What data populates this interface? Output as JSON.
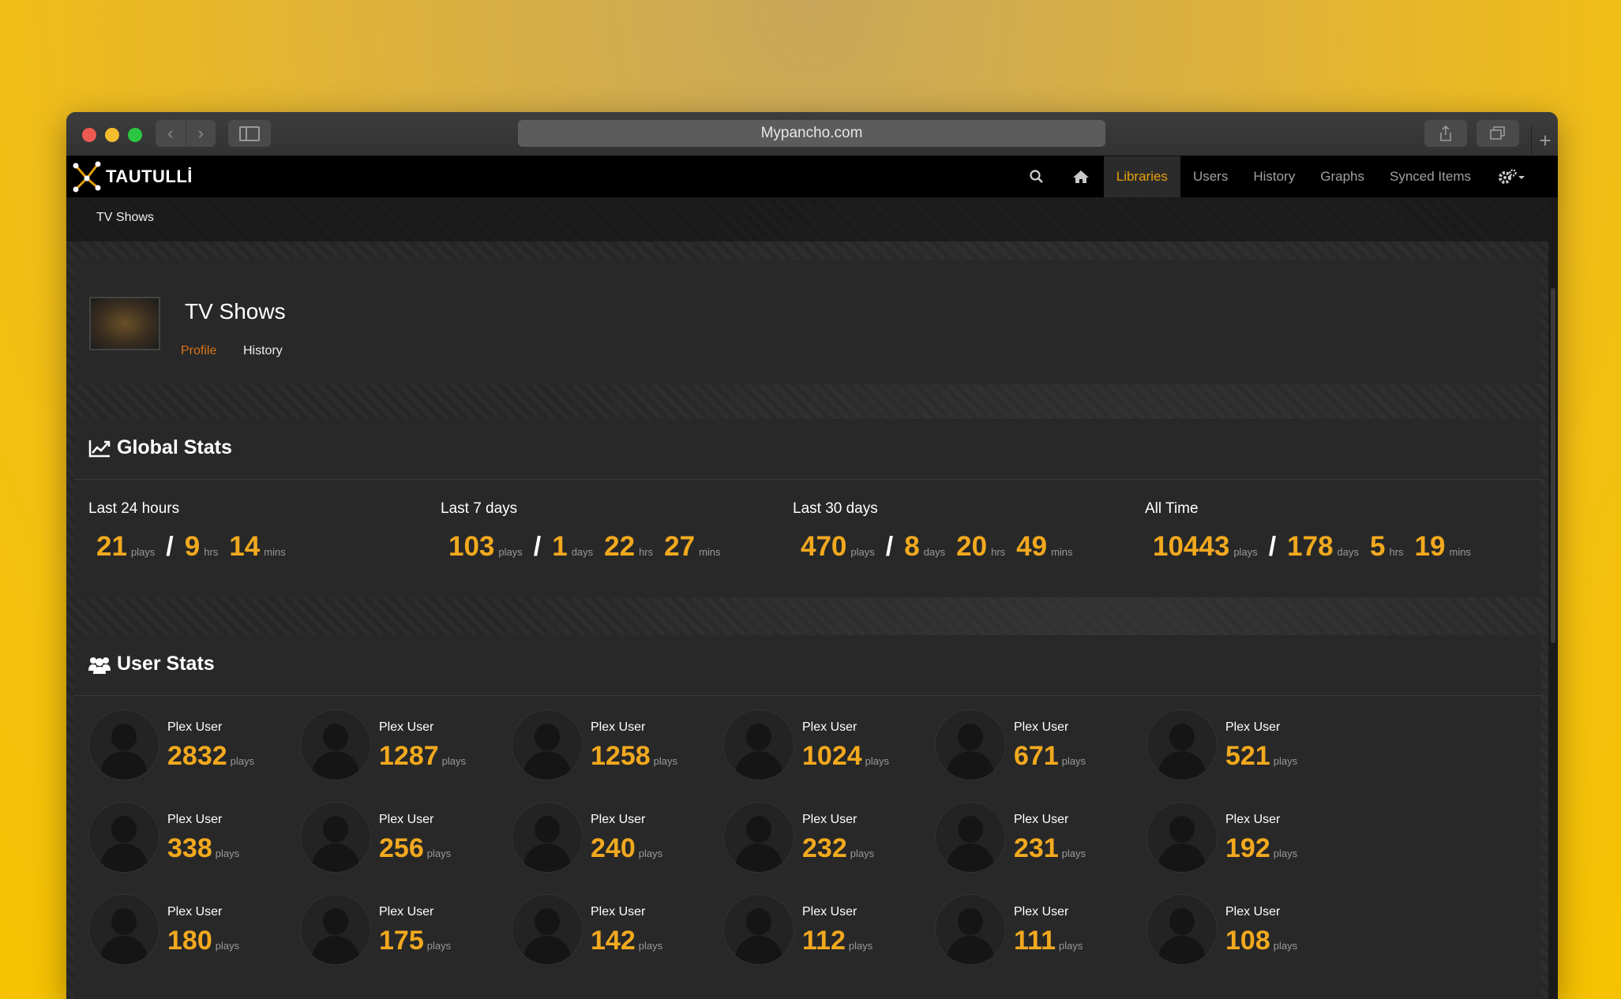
{
  "browser": {
    "url": "Mypancho.com"
  },
  "app": {
    "brand": "TAUTULLİ",
    "nav": {
      "libraries": "Libraries",
      "users": "Users",
      "history": "History",
      "graphs": "Graphs",
      "synced": "Synced Items"
    }
  },
  "breadcrumb": "TV Shows",
  "library": {
    "title": "TV Shows",
    "tabs": {
      "profile": "Profile",
      "history": "History"
    }
  },
  "global_stats": {
    "title": "Global Stats",
    "periods": [
      {
        "label": "Last 24 hours",
        "plays": "21",
        "plays_unit": "plays",
        "days": "",
        "days_unit": "",
        "hrs": "9",
        "hrs_unit": "hrs",
        "mins": "14",
        "mins_unit": "mins"
      },
      {
        "label": "Last 7 days",
        "plays": "103",
        "plays_unit": "plays",
        "days": "1",
        "days_unit": "days",
        "hrs": "22",
        "hrs_unit": "hrs",
        "mins": "27",
        "mins_unit": "mins"
      },
      {
        "label": "Last 30 days",
        "plays": "470",
        "plays_unit": "plays",
        "days": "8",
        "days_unit": "days",
        "hrs": "20",
        "hrs_unit": "hrs",
        "mins": "49",
        "mins_unit": "mins"
      },
      {
        "label": "All Time",
        "plays": "10443",
        "plays_unit": "plays",
        "days": "178",
        "days_unit": "days",
        "hrs": "5",
        "hrs_unit": "hrs",
        "mins": "19",
        "mins_unit": "mins"
      }
    ],
    "slash": "/"
  },
  "user_stats": {
    "title": "User Stats",
    "plays_unit": "plays",
    "users": [
      {
        "name": "Plex User",
        "plays": "2832"
      },
      {
        "name": "Plex User",
        "plays": "1287"
      },
      {
        "name": "Plex User",
        "plays": "1258"
      },
      {
        "name": "Plex User",
        "plays": "1024"
      },
      {
        "name": "Plex User",
        "plays": "671"
      },
      {
        "name": "Plex User",
        "plays": "521"
      },
      {
        "name": "Plex User",
        "plays": "338"
      },
      {
        "name": "Plex User",
        "plays": "256"
      },
      {
        "name": "Plex User",
        "plays": "240"
      },
      {
        "name": "Plex User",
        "plays": "232"
      },
      {
        "name": "Plex User",
        "plays": "231"
      },
      {
        "name": "Plex User",
        "plays": "192"
      },
      {
        "name": "Plex User",
        "plays": "180"
      },
      {
        "name": "Plex User",
        "plays": "175"
      },
      {
        "name": "Plex User",
        "plays": "142"
      },
      {
        "name": "Plex User",
        "plays": "112"
      },
      {
        "name": "Plex User",
        "plays": "111"
      },
      {
        "name": "Plex User",
        "plays": "108"
      }
    ]
  },
  "icons": {
    "search": "search-icon",
    "home": "home-icon",
    "settings": "gears-icon",
    "chart": "line-chart-icon",
    "users": "users-icon"
  },
  "colors": {
    "accent": "#f2a91e",
    "active_nav": "#e5a00d",
    "profile_tab": "#d9741b"
  }
}
